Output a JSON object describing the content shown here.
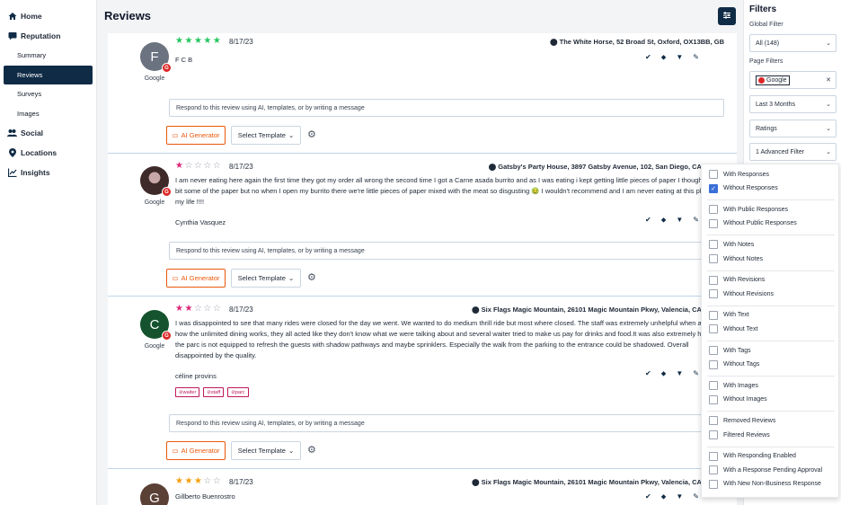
{
  "sidebar": {
    "home": "Home",
    "reputation": "Reputation",
    "summary": "Summary",
    "reviews": "Reviews",
    "surveys": "Surveys",
    "images": "Images",
    "social": "Social",
    "locations": "Locations",
    "insights": "Insights"
  },
  "main": {
    "title": "Reviews"
  },
  "reviews": [
    {
      "initial": "F",
      "avatar_color": "#6b7280",
      "source": "Google",
      "rating": 5,
      "date": "8/17/23",
      "location": "The White Horse, 52 Broad St, Oxford, OX13BB, GB",
      "text": "",
      "author": "F C B",
      "respond_placeholder": "Respond to this review using AI, templates, or by writing a message",
      "ai_label": "AI Generator",
      "template_label": "Select Template"
    },
    {
      "initial": "",
      "avatar_color": "#3f2a2a",
      "source": "Google",
      "rating": 1,
      "date": "8/17/23",
      "location": "Gatsby's Party House, 3897 Gatsby Avenue, 102, San Diego, CA, 92101",
      "text": "I am never eating here again the first time they got my order all wrong the second time I got a Carne asada burrito and as I was eating i kept getting little pieces of paper I thought I had bit some of the paper but no when I open my burrito there we're little pieces of paper mixed with the meat so disgusting 🤢 I wouldn't recommend and I am never eating at this place in my life !!!!",
      "author": "Cynthia Vasquez",
      "respond_placeholder": "Respond to this review using AI, templates, or by writing a message",
      "ai_label": "AI Generator",
      "template_label": "Select Template"
    },
    {
      "initial": "C",
      "avatar_color": "#14532d",
      "source": "Google",
      "rating": 2,
      "date": "8/17/23",
      "location": "Six Flags Magic Mountain, 26101 Magic Mountain Pkwy, Valencia, CA, 91355",
      "text": "I was disappointed to see that many rides were closed for the day we went. We wanted to do medium thrill ride but most where closed. The staff was extremely unhelpful when asked how the unlimited dining works, they all acted like they don't know what we were talking about and several waiter tried to make us pay for drinks and food.It was also extremely hot and the parc is not equipped to refresh the guests with shadow pathways and maybe sprinklers. Especially the walk from the parking to the entrance could be shadowed. Overall disappointed by the quality.",
      "author": "céline provins",
      "tags": [
        "waiter",
        "staff",
        "parc"
      ],
      "respond_placeholder": "Respond to this review using AI, templates, or by writing a message",
      "ai_label": "AI Generator",
      "template_label": "Select Template"
    },
    {
      "initial": "G",
      "avatar_color": "#5b4036",
      "source": "Google",
      "rating": 3,
      "date": "8/17/23",
      "location": "Six Flags Magic Mountain, 26101 Magic Mountain Pkwy, Valencia, CA, 91355",
      "text": "",
      "author": "Gillberto Buenrostro"
    }
  ],
  "filters": {
    "title": "Filters",
    "global_label": "Global Filter",
    "global_value": "All (148)",
    "page_label": "Page Filters",
    "source_chip": "Google",
    "date_range": "Last 3 Months",
    "ratings": "Ratings",
    "advanced": "1 Advanced Filter"
  },
  "advanced_options": [
    {
      "label": "With Responses",
      "checked": false
    },
    {
      "label": "Without Responses",
      "checked": true
    },
    {
      "label": "With Public Responses",
      "checked": false
    },
    {
      "label": "Without Public Responses",
      "checked": false
    },
    {
      "label": "With Notes",
      "checked": false
    },
    {
      "label": "Without Notes",
      "checked": false
    },
    {
      "label": "With Revisions",
      "checked": false
    },
    {
      "label": "Without Revisions",
      "checked": false
    },
    {
      "label": "With Text",
      "checked": false
    },
    {
      "label": "Without Text",
      "checked": false
    },
    {
      "label": "With Tags",
      "checked": false
    },
    {
      "label": "Without Tags",
      "checked": false
    },
    {
      "label": "With Images",
      "checked": false
    },
    {
      "label": "Without Images",
      "checked": false
    },
    {
      "label": "Removed Reviews",
      "checked": false
    },
    {
      "label": "Filtered Reviews",
      "checked": false
    },
    {
      "label": "With Responding Enabled",
      "checked": false
    },
    {
      "label": "With a Response Pending Approval",
      "checked": false
    },
    {
      "label": "With New Non-Business Response",
      "checked": false
    }
  ],
  "colors": {
    "navy": "#0f2b46",
    "star_green": "#22c55e",
    "star_pink": "#db2777",
    "star_orange": "#f59e0b",
    "accent_orange": "#ea580c"
  }
}
